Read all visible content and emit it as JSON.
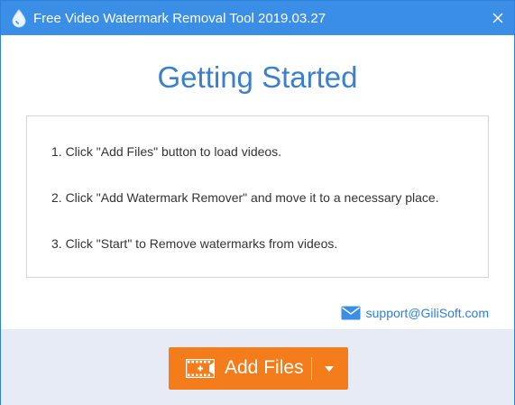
{
  "window": {
    "title": "Free Video Watermark Removal Tool 2019.03.27"
  },
  "main": {
    "heading": "Getting Started",
    "steps": [
      "1. Click \"Add Files\" button to load videos.",
      "2. Click \"Add Watermark Remover\" and move it to a necessary place.",
      "3. Click \"Start\" to Remove watermarks from videos."
    ],
    "support_email": "support@GiliSoft.com"
  },
  "footer": {
    "add_files_label": "Add Files"
  },
  "colors": {
    "titlebar": "#3a8ee6",
    "heading": "#3a7fd0",
    "accent_button": "#f47c1a",
    "footer_bg": "#e6ebf5",
    "link": "#2f7ed8"
  },
  "icons": {
    "app": "water-drop-icon",
    "close": "close-icon",
    "mail": "mail-icon",
    "film": "film-add-icon",
    "dropdown": "caret-down-icon"
  }
}
